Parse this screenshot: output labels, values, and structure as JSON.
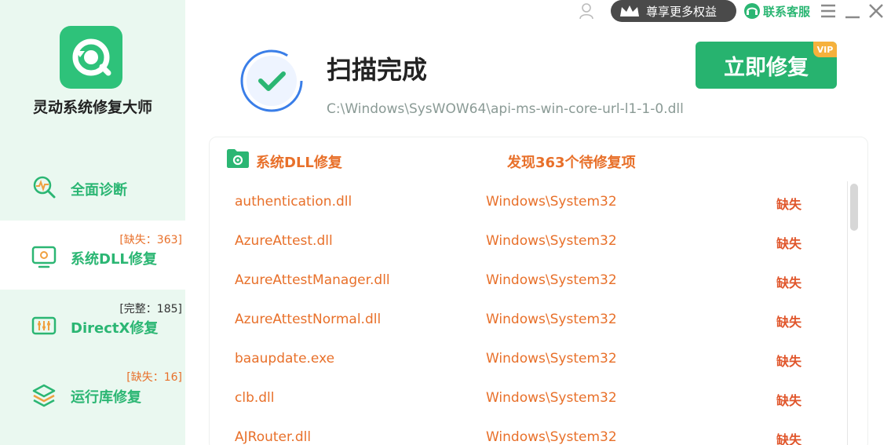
{
  "app": {
    "name": "灵动系统修复大师"
  },
  "sidebar": {
    "items": [
      {
        "label": "全面诊断",
        "badge": ""
      },
      {
        "label": "系统DLL修复",
        "badge": "[缺失：363]"
      },
      {
        "label": "DirectX修复",
        "badge": "[完整：185]"
      },
      {
        "label": "运行库修复",
        "badge": "[缺失：16]"
      }
    ]
  },
  "topbar": {
    "vip_label": "尊享更多权益",
    "service_label": "联系客服"
  },
  "status": {
    "title": "扫描完成",
    "path": "C:\\Windows\\SysWOW64\\api-ms-win-core-url-l1-1-0.dll",
    "repair_button": "立即修复",
    "vip_tag": "VIP"
  },
  "panel": {
    "title": "系统DLL修复",
    "summary": "发现363个待修复项",
    "rows": [
      {
        "name": "authentication.dll",
        "path": "Windows\\System32",
        "status": "缺失"
      },
      {
        "name": "AzureAttest.dll",
        "path": "Windows\\System32",
        "status": "缺失"
      },
      {
        "name": "AzureAttestManager.dll",
        "path": "Windows\\System32",
        "status": "缺失"
      },
      {
        "name": "AzureAttestNormal.dll",
        "path": "Windows\\System32",
        "status": "缺失"
      },
      {
        "name": "baaupdate.exe",
        "path": "Windows\\System32",
        "status": "缺失"
      },
      {
        "name": "clb.dll",
        "path": "Windows\\System32",
        "status": "缺失"
      },
      {
        "name": "AJRouter.dll",
        "path": "Windows\\System32",
        "status": "缺失"
      }
    ]
  },
  "colors": {
    "brand_green": "#27b36f",
    "warning_orange": "#e8702a",
    "sidebar_bg": "#eaf8f0",
    "vip_gold": "#f6b13c"
  },
  "icons": {
    "logo": "refresh-magnifier-icon",
    "diagnose": "diagnose-icon",
    "dll": "monitor-gear-icon",
    "directx": "equalizer-icon",
    "runtime": "layers-icon"
  }
}
